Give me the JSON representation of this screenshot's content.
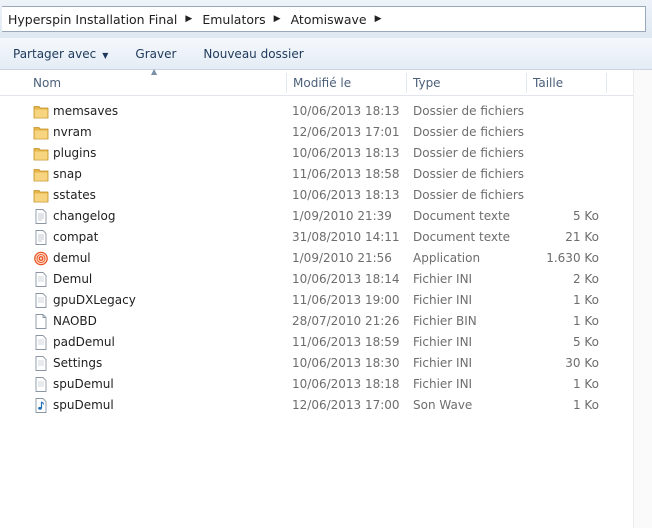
{
  "breadcrumb": [
    "Hyperspin Installation Final",
    "Emulators",
    "Atomiswave"
  ],
  "toolbar": {
    "share": "Partager avec",
    "burn": "Graver",
    "new_folder": "Nouveau dossier"
  },
  "columns": {
    "name": "Nom",
    "modified": "Modifié le",
    "type": "Type",
    "size": "Taille"
  },
  "files": [
    {
      "name": "memsaves",
      "date": "10/06/2013 18:13",
      "type": "Dossier de fichiers",
      "size": "",
      "icon": "folder-icon"
    },
    {
      "name": "nvram",
      "date": "12/06/2013 17:01",
      "type": "Dossier de fichiers",
      "size": "",
      "icon": "folder-icon"
    },
    {
      "name": "plugins",
      "date": "10/06/2013 18:13",
      "type": "Dossier de fichiers",
      "size": "",
      "icon": "folder-icon"
    },
    {
      "name": "snap",
      "date": "11/06/2013 18:58",
      "type": "Dossier de fichiers",
      "size": "",
      "icon": "folder-icon"
    },
    {
      "name": "sstates",
      "date": "10/06/2013 18:13",
      "type": "Dossier de fichiers",
      "size": "",
      "icon": "folder-icon"
    },
    {
      "name": "changelog",
      "date": "1/09/2010 21:39",
      "type": "Document texte",
      "size": "5 Ko",
      "icon": "text-file-icon"
    },
    {
      "name": "compat",
      "date": "31/08/2010 14:11",
      "type": "Document texte",
      "size": "21 Ko",
      "icon": "text-file-icon"
    },
    {
      "name": "demul",
      "date": "1/09/2010 21:56",
      "type": "Application",
      "size": "1.630 Ko",
      "icon": "application-icon"
    },
    {
      "name": "Demul",
      "date": "10/06/2013 18:14",
      "type": "Fichier INI",
      "size": "2 Ko",
      "icon": "ini-file-icon"
    },
    {
      "name": "gpuDXLegacy",
      "date": "11/06/2013 19:00",
      "type": "Fichier INI",
      "size": "1 Ko",
      "icon": "ini-file-icon"
    },
    {
      "name": "NAOBD",
      "date": "28/07/2010 21:26",
      "type": "Fichier BIN",
      "size": "1 Ko",
      "icon": "blank-file-icon"
    },
    {
      "name": "padDemul",
      "date": "11/06/2013 18:59",
      "type": "Fichier INI",
      "size": "5 Ko",
      "icon": "ini-file-icon"
    },
    {
      "name": "Settings",
      "date": "10/06/2013 18:30",
      "type": "Fichier INI",
      "size": "30 Ko",
      "icon": "ini-file-icon"
    },
    {
      "name": "spuDemul",
      "date": "10/06/2013 18:18",
      "type": "Fichier INI",
      "size": "1 Ko",
      "icon": "ini-file-icon"
    },
    {
      "name": "spuDemul",
      "date": "12/06/2013 17:00",
      "type": "Son Wave",
      "size": "1 Ko",
      "icon": "audio-file-icon"
    }
  ]
}
